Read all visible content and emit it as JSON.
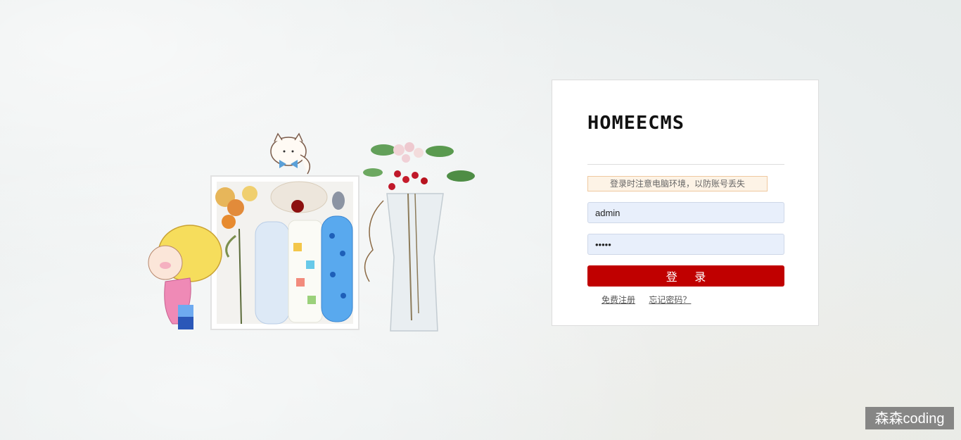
{
  "login": {
    "logo_text": "HOMEECMS",
    "notice": "登录时注意电脑环境，以防账号丢失",
    "username_value": "admin",
    "password_value": "•••••",
    "submit_label": "登 录",
    "register_link": "免费注册",
    "forgot_link": "忘记密码？"
  },
  "watermark": "森森coding",
  "colors": {
    "button": "#c00000",
    "input_bg": "#e8effb",
    "notice_bg": "#fdf3e6",
    "notice_border": "#f0c9a0"
  }
}
